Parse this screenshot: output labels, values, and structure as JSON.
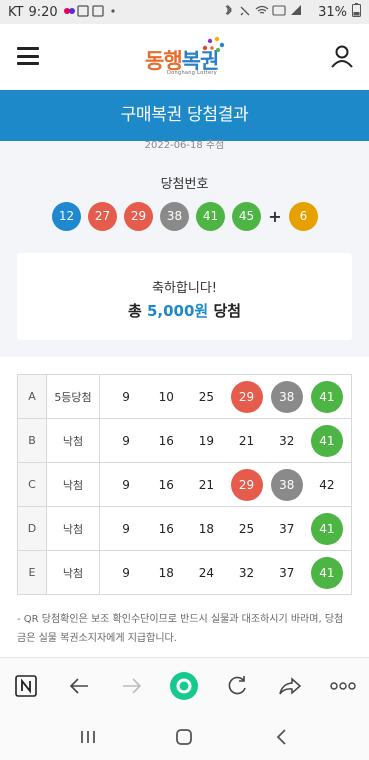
{
  "status_bar": {
    "carrier": "KT",
    "time": "9:20",
    "battery": "31%"
  },
  "header": {
    "logo_text_1": "동행",
    "logo_text_2": "복권",
    "logo_sub": "Donghang Lottery"
  },
  "banner": {
    "title": "구매복권 당첨결과"
  },
  "draw": {
    "date": "2022-06-18 추첨",
    "label": "당첨번호",
    "numbers": [
      12,
      27,
      29,
      38,
      41,
      45
    ],
    "bonus": 6,
    "ball_colors": {
      "yellow": "#e5a100",
      "blue": "#1e88d1",
      "red": "#e55c4c",
      "gray": "#8a8a8a",
      "green": "#4db543"
    }
  },
  "result": {
    "congrats": "축하합니다!",
    "prize_prefix": "총 ",
    "prize_amount": "5,000원",
    "prize_suffix": " 당첨"
  },
  "games": [
    {
      "game": "A",
      "status": "5등당첨",
      "numbers": [
        9,
        10,
        25,
        29,
        38,
        41
      ],
      "hits": [
        29,
        38,
        41
      ]
    },
    {
      "game": "B",
      "status": "낙첨",
      "numbers": [
        9,
        16,
        19,
        21,
        32,
        41
      ],
      "hits": [
        41
      ]
    },
    {
      "game": "C",
      "status": "낙첨",
      "numbers": [
        9,
        16,
        21,
        29,
        38,
        42
      ],
      "hits": [
        29,
        38
      ]
    },
    {
      "game": "D",
      "status": "낙첨",
      "numbers": [
        9,
        16,
        18,
        25,
        37,
        41
      ],
      "hits": [
        41
      ]
    },
    {
      "game": "E",
      "status": "낙첨",
      "numbers": [
        9,
        18,
        24,
        32,
        37,
        41
      ],
      "hits": [
        41
      ]
    }
  ],
  "notice": "- QR 당첨확인은 보조 확인수단이므로 반드시 실물과 대조하시기 바라며, 당첨금은 실물 복권소지자에게 지급합니다.",
  "browser_bar": [
    "naver-home-icon",
    "back-arrow-icon",
    "forward-arrow-icon",
    "green-dot-icon",
    "refresh-icon",
    "share-icon",
    "more-icon"
  ],
  "nav_bar": [
    "recent-apps-icon",
    "home-icon",
    "back-icon"
  ]
}
